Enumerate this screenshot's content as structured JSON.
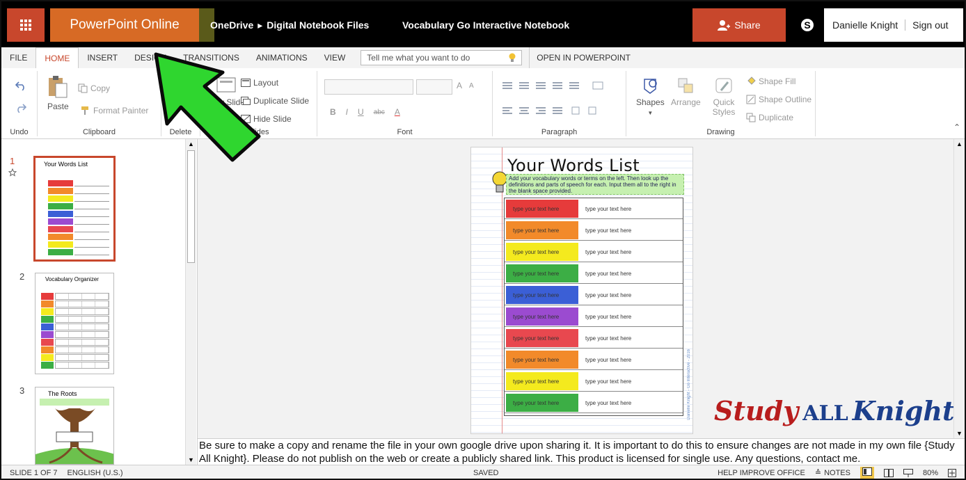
{
  "app": {
    "brand": "PowerPoint Online",
    "breadcrumb": [
      "OneDrive",
      "Digital Notebook Files"
    ],
    "doc_title": "Vocabulary Go Interactive Notebook",
    "share_label": "Share",
    "user_name": "Danielle Knight",
    "sign_out": "Sign out"
  },
  "tabs": {
    "file": "FILE",
    "home": "HOME",
    "insert": "INSERT",
    "design": "DESIGN",
    "transitions": "TRANSITIONS",
    "animations": "ANIMATIONS",
    "view": "VIEW",
    "tell_me_placeholder": "Tell me what you want to do",
    "open_in_app": "OPEN IN POWERPOINT"
  },
  "ribbon": {
    "undo_group": "Undo",
    "clipboard": {
      "paste": "Paste",
      "copy": "Copy",
      "format_painter": "Format Painter",
      "label": "Clipboard"
    },
    "delete": {
      "button": "Delete",
      "label": "Delete"
    },
    "slides": {
      "new_slide": "New Slide",
      "layout": "Layout",
      "duplicate": "Duplicate Slide",
      "hide": "Hide Slide",
      "label": "Slides"
    },
    "font": {
      "bold": "B",
      "italic": "I",
      "underline": "U",
      "strike": "abc",
      "color": "A",
      "grow": "A",
      "shrink": "A",
      "label": "Font"
    },
    "paragraph": {
      "label": "Paragraph"
    },
    "drawing": {
      "shapes": "Shapes",
      "arrange": "Arrange",
      "quick_styles": "Quick Styles",
      "shape_fill": "Shape Fill",
      "shape_outline": "Shape Outline",
      "duplicate": "Duplicate",
      "label": "Drawing"
    }
  },
  "thumbnails": [
    {
      "num": "1",
      "title": "Your Words List",
      "selected": true
    },
    {
      "num": "2",
      "title": "Vocabulary Organizer",
      "selected": false
    },
    {
      "num": "3",
      "title": "The Roots",
      "selected": false
    }
  ],
  "slide": {
    "title": "Your Words List",
    "instructions": "Add your vocabulary words or terms on the left. Then look up the definitions and parts of speech for each. Input them all to the right in the blank space provided.",
    "rows": [
      {
        "left": "type your text here",
        "right": "type your text here",
        "color": "#e63b3b"
      },
      {
        "left": "type your text here",
        "right": "type your text here",
        "color": "#f28a2a"
      },
      {
        "left": "type your text here",
        "right": "type your text here",
        "color": "#f4ea1e"
      },
      {
        "left": "type your text here",
        "right": "type your text here",
        "color": "#3cae45"
      },
      {
        "left": "type your text here",
        "right": "type your text here",
        "color": "#3b5fd6"
      },
      {
        "left": "type your text here",
        "right": "type your text here",
        "color": "#9b4bd0"
      },
      {
        "left": "type your text here",
        "right": "type your text here",
        "color": "#e8484f"
      },
      {
        "left": "type your text here",
        "right": "type your text here",
        "color": "#f28a2a"
      },
      {
        "left": "type your text here",
        "right": "type your text here",
        "color": "#f4ea1e"
      },
      {
        "left": "type your text here",
        "right": "type your text here",
        "color": "#3cae45"
      }
    ],
    "credit": "Danielle Knight - Go Interactive - 2016"
  },
  "logo": {
    "w1": "Study",
    "w2": "ALL",
    "w3": "Knight"
  },
  "notes": "Be sure to make a copy and rename the file in your own google drive upon sharing it. It is important to do this to ensure changes are not made in my own file {Study All Knight}. Please do not publish on the web or create a publicly shared link. This product is licensed for single use. Any questions, contact me.",
  "status": {
    "slide_count": "SLIDE 1 OF 7",
    "language": "ENGLISH (U.S.)",
    "saved": "SAVED",
    "help": "HELP IMPROVE OFFICE",
    "notes": "NOTES",
    "zoom": "80%"
  },
  "colors": {
    "accent": "#c8472c",
    "brand_orange": "#d76a25",
    "arrow": "#2fd62f"
  }
}
